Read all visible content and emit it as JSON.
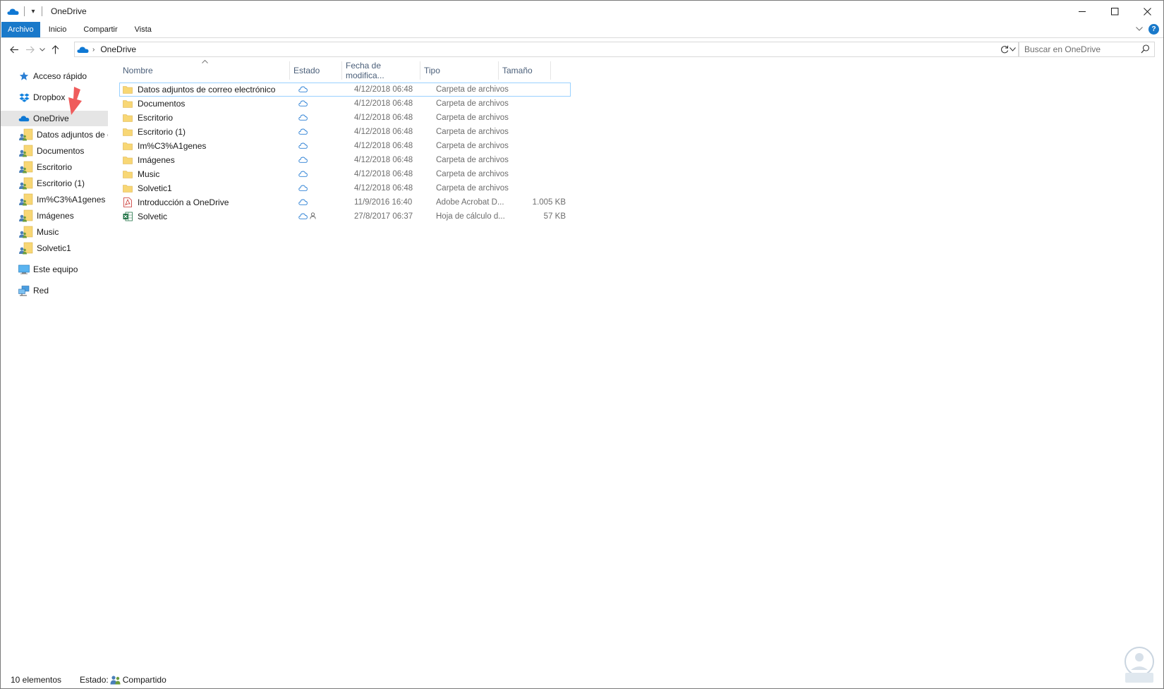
{
  "window": {
    "title": "OneDrive",
    "controls": {
      "minimize": "—",
      "maximize": "☐",
      "close": "✕"
    }
  },
  "ribbon": {
    "tabs": [
      {
        "label": "Archivo"
      },
      {
        "label": "Inicio"
      },
      {
        "label": "Compartir"
      },
      {
        "label": "Vista"
      }
    ],
    "help": "?"
  },
  "address": {
    "path": "OneDrive",
    "search_placeholder": "Buscar en OneDrive"
  },
  "sidebar": {
    "quick_access": "Acceso rápido",
    "dropbox": "Dropbox",
    "onedrive": "OneDrive",
    "onedrive_children": [
      "Datos adjuntos de c",
      "Documentos",
      "Escritorio",
      "Escritorio (1)",
      "Im%C3%A1genes",
      "Imágenes",
      "Music",
      "Solvetic1"
    ],
    "this_pc": "Este equipo",
    "network": "Red"
  },
  "columns": {
    "name": "Nombre",
    "status": "Estado",
    "date": "Fecha de modifica...",
    "type": "Tipo",
    "size": "Tamaño"
  },
  "files": [
    {
      "name": "Datos adjuntos de correo electrónico",
      "icon": "folder-icon",
      "date": "4/12/2018 06:48",
      "type": "Carpeta de archivos",
      "size": ""
    },
    {
      "name": "Documentos",
      "icon": "folder-icon",
      "date": "4/12/2018 06:48",
      "type": "Carpeta de archivos",
      "size": ""
    },
    {
      "name": "Escritorio",
      "icon": "folder-icon",
      "date": "4/12/2018 06:48",
      "type": "Carpeta de archivos",
      "size": ""
    },
    {
      "name": "Escritorio (1)",
      "icon": "folder-icon",
      "date": "4/12/2018 06:48",
      "type": "Carpeta de archivos",
      "size": ""
    },
    {
      "name": "Im%C3%A1genes",
      "icon": "folder-icon",
      "date": "4/12/2018 06:48",
      "type": "Carpeta de archivos",
      "size": ""
    },
    {
      "name": "Imágenes",
      "icon": "folder-icon",
      "date": "4/12/2018 06:48",
      "type": "Carpeta de archivos",
      "size": ""
    },
    {
      "name": "Music",
      "icon": "folder-icon",
      "date": "4/12/2018 06:48",
      "type": "Carpeta de archivos",
      "size": ""
    },
    {
      "name": "Solvetic1",
      "icon": "folder-icon",
      "date": "4/12/2018 06:48",
      "type": "Carpeta de archivos",
      "size": ""
    },
    {
      "name": "Introducción a OneDrive",
      "icon": "pdf-icon",
      "date": "11/9/2016 16:40",
      "type": "Adobe Acrobat D...",
      "size": "1.005 KB"
    },
    {
      "name": "Solvetic",
      "icon": "excel-icon",
      "date": "27/8/2017 06:37",
      "type": "Hoja de cálculo d...",
      "size": "57 KB",
      "shared": true
    }
  ],
  "statusbar": {
    "count": "10 elementos",
    "state_label": "Estado:",
    "state_value": "Compartido"
  },
  "colors": {
    "accent": "#1979ca",
    "onedrive_blue": "#0f78d4",
    "folder_yellow": "#f8d775",
    "selection_outline": "#99d1ff",
    "annotation_red": "#ef5c5c"
  }
}
